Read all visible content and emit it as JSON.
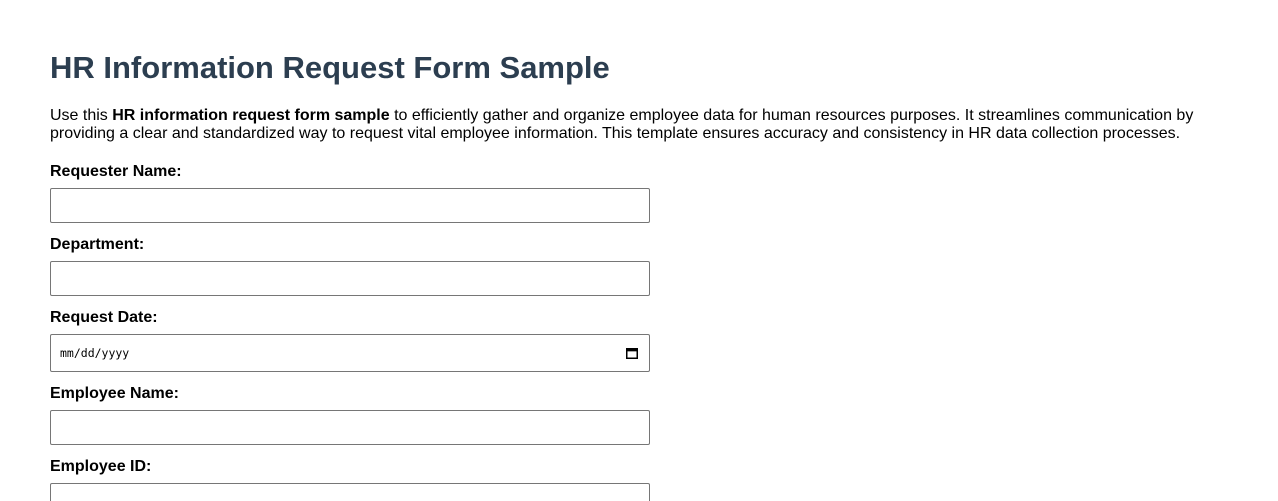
{
  "page": {
    "title": "HR Information Request Form Sample",
    "intro": {
      "before": "Use this ",
      "bold": "HR information request form sample",
      "after": " to efficiently gather and organize employee data for human resources purposes. It streamlines communication by providing a clear and standardized way to request vital employee information. This template ensures accuracy and consistency in HR data collection processes."
    }
  },
  "form": {
    "requester_name": {
      "label": "Requester Name:",
      "value": ""
    },
    "department": {
      "label": "Department:",
      "value": ""
    },
    "request_date": {
      "label": "Request Date:",
      "placeholder": "mm/dd/yyyy",
      "icon": "calendar-icon"
    },
    "employee_name": {
      "label": "Employee Name:",
      "value": ""
    },
    "employee_id": {
      "label": "Employee ID:",
      "value": ""
    }
  },
  "colors": {
    "heading": "#2c3e50",
    "text": "#000000",
    "input_border": "#767676",
    "background": "#ffffff"
  }
}
